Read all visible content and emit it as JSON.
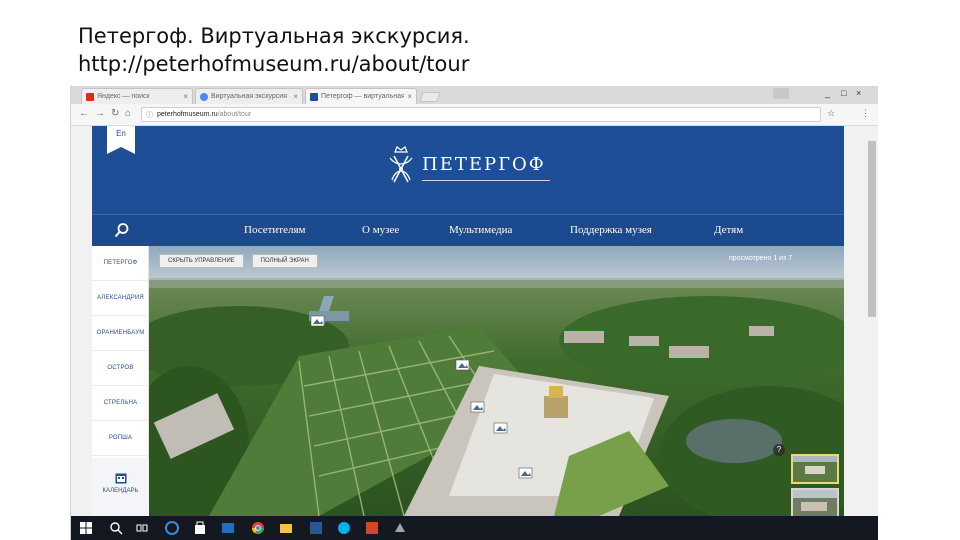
{
  "slide": {
    "title_line1": "Петергоф. Виртуальная экскурсия.",
    "title_line2": "http://peterhofmuseum.ru/about/tour"
  },
  "browser": {
    "tabs": [
      {
        "label": "Яндекс — поиск",
        "favicon": "yandex-icon",
        "color": "#e52620"
      },
      {
        "label": "Виртуальная экскурсия",
        "favicon": "chrome-icon",
        "color": "#4a8af4"
      },
      {
        "label": "Петергоф — виртуальная",
        "favicon": "peterhof-icon",
        "color": "#1e4f96"
      }
    ],
    "url_host": "peterhofmuseum.ru",
    "url_path": "/about/tour",
    "window_controls": {
      "minimize": "_",
      "maximize": "□",
      "close": "×"
    }
  },
  "site": {
    "lang_switch": "En",
    "logo_title": "ПЕТЕРГОФ",
    "nav": [
      "Посетителям",
      "О музее",
      "Мультимедиа",
      "Поддержка музея",
      "Детям"
    ],
    "sidebar": [
      "ПЕТЕРГОФ",
      "АЛЕКСАНДРИЯ",
      "ОРАНИЕНБАУМ",
      "ОСТРОВ",
      "СТРЕЛЬНА",
      "РОПША"
    ],
    "calendar_label": "КАЛЕНДАРЬ",
    "pano_buttons": [
      "СКРЫТЬ УПРАВЛЕНИЕ",
      "ПОЛНЫЙ ЭКРАН"
    ],
    "pano_counter": "просмотрено 1 из 7",
    "marker_label": "?"
  },
  "colors": {
    "brand_blue": "#1e4f96",
    "nav_blue": "#1b4a8f",
    "taskbar": "#141820"
  }
}
